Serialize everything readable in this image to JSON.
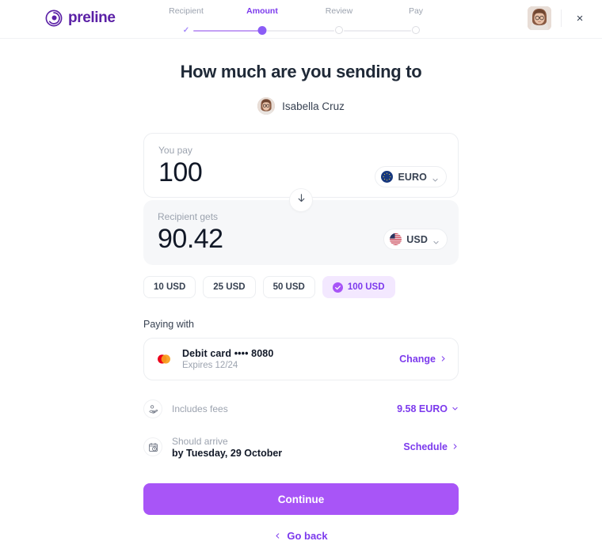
{
  "brand": {
    "name": "preline",
    "logo_color": "#5b21a6"
  },
  "header": {
    "close_label": "×",
    "steps": [
      {
        "label": "Recipient",
        "state": "done"
      },
      {
        "label": "Amount",
        "state": "current"
      },
      {
        "label": "Review",
        "state": "todo"
      },
      {
        "label": "Pay",
        "state": "todo"
      }
    ]
  },
  "main": {
    "title": "How much are you sending to",
    "recipient_name": "Isabella Cruz"
  },
  "amounts": {
    "pay_label": "You pay",
    "pay_value": "100",
    "pay_currency": "EURO",
    "gets_label": "Recipient gets",
    "gets_value": "90.42",
    "gets_currency": "USD",
    "swap_icon": "arrow-down-icon"
  },
  "chips": [
    {
      "label": "10 USD",
      "selected": false
    },
    {
      "label": "25 USD",
      "selected": false
    },
    {
      "label": "50 USD",
      "selected": false
    },
    {
      "label": "100 USD",
      "selected": true
    }
  ],
  "payment": {
    "section_label": "Paying with",
    "card_title": "Debit card •••• 8080",
    "card_sub": "Expires 12/24",
    "change_label": "Change",
    "brand_icon": "mastercard-icon"
  },
  "details": {
    "fees_label": "Includes fees",
    "fees_value": "9.58 EURO",
    "fees_icon": "coins-hand-icon",
    "arrive_label": "Should arrive",
    "arrive_value": "by Tuesday, 29 October",
    "arrive_icon": "calendar-clock-icon",
    "schedule_label": "Schedule"
  },
  "footer": {
    "continue_label": "Continue",
    "goback_label": "Go back"
  },
  "colors": {
    "accent": "#7c3aed",
    "button": "#a855f7",
    "chip_active_bg": "#f3e8ff",
    "muted": "#9ca3af"
  }
}
